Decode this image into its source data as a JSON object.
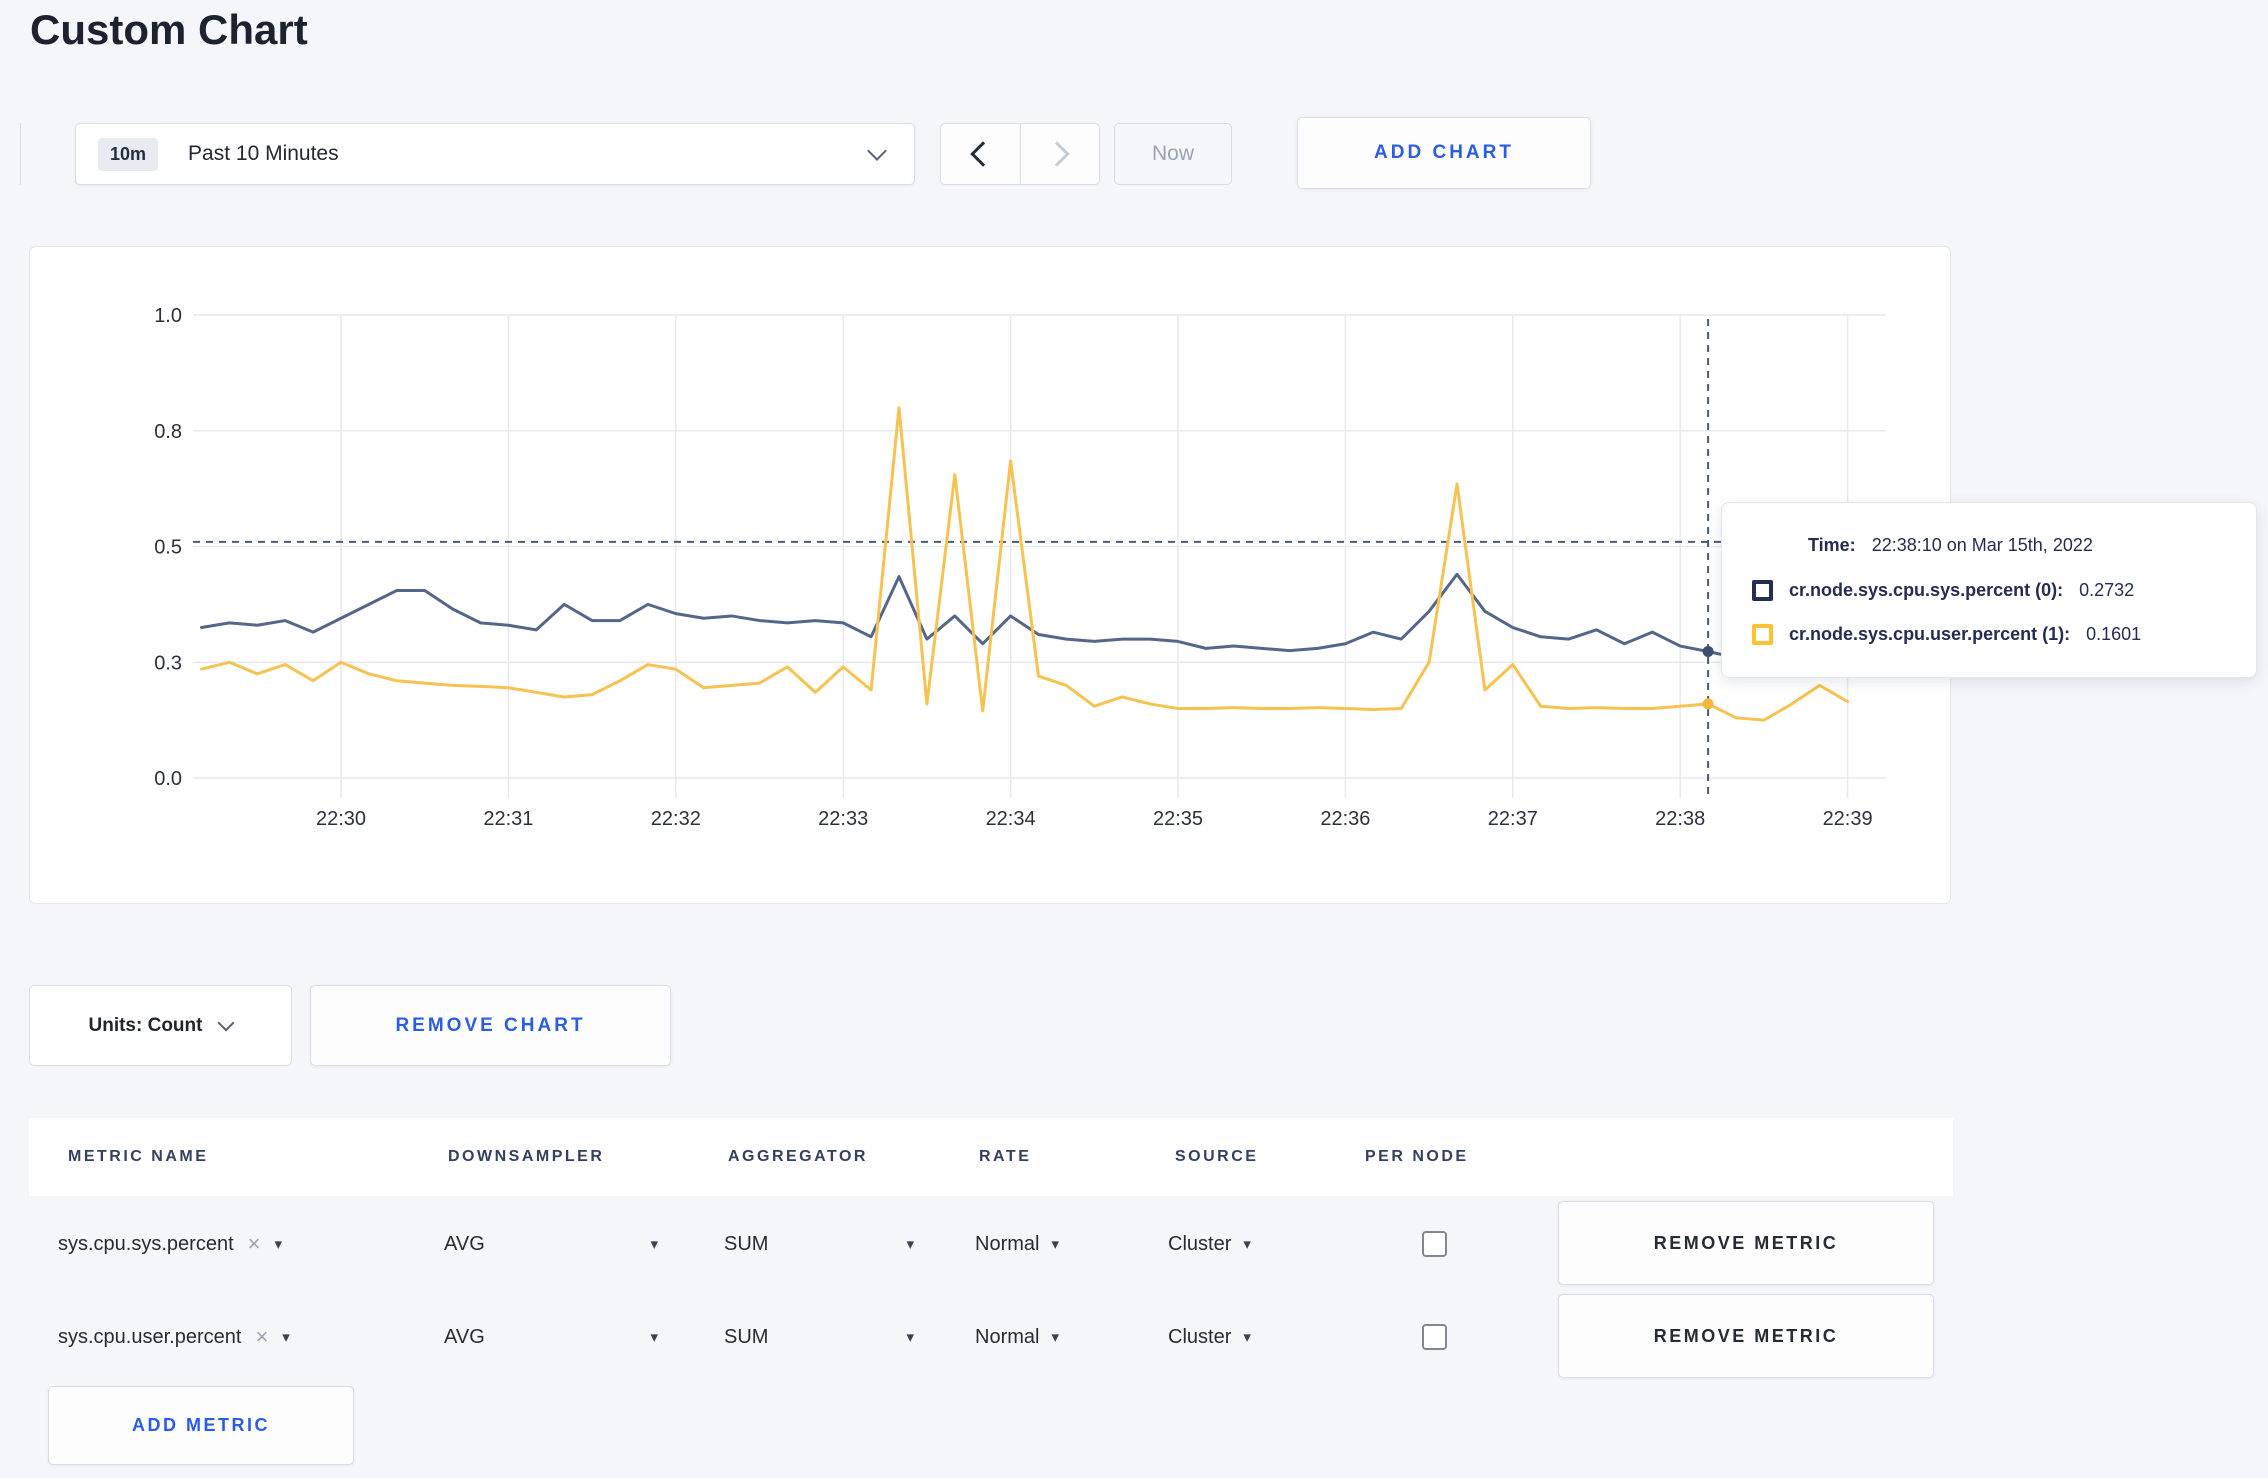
{
  "page": {
    "title": "Custom Chart",
    "background": "#f4f6fa",
    "accent_blue": "#2a5ce4"
  },
  "toolbar": {
    "time_window_badge": "10m",
    "time_window_label": "Past 10 Minutes",
    "now_label": "Now",
    "add_chart_label": "ADD CHART"
  },
  "chart": {
    "tooltip": {
      "time_label": "Time:",
      "time_value": "22:38:10 on Mar 15th, 2022",
      "rows": [
        {
          "label": "cr.node.sys.cpu.sys.percent (0):",
          "value": "0.2732",
          "swatch": "#242f55"
        },
        {
          "label": "cr.node.sys.cpu.user.percent (1):",
          "value": "0.1601",
          "swatch": "#fdc134"
        }
      ]
    }
  },
  "chart_data": {
    "type": "line",
    "title": "",
    "xlabel": "",
    "ylabel": "",
    "ylim": [
      0,
      1
    ],
    "grid": true,
    "x_start": "22:29:10",
    "x_interval_seconds": 10,
    "x_tick_labels": [
      "22:30",
      "22:31",
      "22:32",
      "22:33",
      "22:34",
      "22:35",
      "22:36",
      "22:37",
      "22:38",
      "22:39"
    ],
    "y_ticks": [
      {
        "value": 0.0,
        "label": "0.0"
      },
      {
        "value": 0.25,
        "label": "0.3"
      },
      {
        "value": 0.5,
        "label": "0.5"
      },
      {
        "value": 0.75,
        "label": "0.8"
      },
      {
        "value": 1.0,
        "label": "1.0"
      }
    ],
    "series": [
      {
        "name": "cr.node.sys.cpu.sys.percent",
        "color": "#54668a",
        "values": [
          0.325,
          0.335,
          0.33,
          0.34,
          0.315,
          0.345,
          0.375,
          0.405,
          0.405,
          0.365,
          0.335,
          0.33,
          0.32,
          0.375,
          0.34,
          0.34,
          0.375,
          0.355,
          0.345,
          0.35,
          0.34,
          0.335,
          0.34,
          0.335,
          0.305,
          0.435,
          0.3,
          0.35,
          0.29,
          0.35,
          0.31,
          0.3,
          0.295,
          0.3,
          0.3,
          0.295,
          0.28,
          0.285,
          0.28,
          0.275,
          0.28,
          0.29,
          0.315,
          0.3,
          0.36,
          0.44,
          0.36,
          0.325,
          0.305,
          0.3,
          0.32,
          0.29,
          0.315,
          0.285,
          0.2732,
          0.26,
          0.285,
          0.31,
          0.3,
          0.29
        ]
      },
      {
        "name": "cr.node.sys.cpu.user.percent",
        "color": "#f6c251",
        "values": [
          0.235,
          0.25,
          0.225,
          0.245,
          0.21,
          0.25,
          0.225,
          0.21,
          0.205,
          0.2,
          0.198,
          0.195,
          0.185,
          0.175,
          0.18,
          0.21,
          0.245,
          0.235,
          0.195,
          0.2,
          0.205,
          0.24,
          0.185,
          0.24,
          0.19,
          0.8,
          0.16,
          0.655,
          0.145,
          0.685,
          0.22,
          0.2,
          0.155,
          0.175,
          0.16,
          0.15,
          0.15,
          0.152,
          0.15,
          0.15,
          0.152,
          0.15,
          0.148,
          0.15,
          0.25,
          0.635,
          0.19,
          0.245,
          0.155,
          0.15,
          0.152,
          0.15,
          0.15,
          0.155,
          0.1601,
          0.13,
          0.125,
          0.16,
          0.2,
          0.165
        ]
      }
    ],
    "hover": {
      "time": "22:38:10",
      "x_index": 54,
      "hline_value": 0.51,
      "values": [
        0.2732,
        0.1601
      ],
      "dot_colors": [
        "#3d4e6e",
        "#f2b83e"
      ],
      "crosshair_color": "#4a5a74"
    },
    "legend_position": "tooltip-only"
  },
  "units_row": {
    "units_label": "Units: Count",
    "remove_chart_label": "REMOVE CHART"
  },
  "metrics_table": {
    "headers": [
      "METRIC NAME",
      "DOWNSAMPLER",
      "AGGREGATOR",
      "RATE",
      "SOURCE",
      "PER NODE"
    ],
    "rows": [
      {
        "metric": "sys.cpu.sys.percent",
        "remove_icon": "×",
        "downsampler": "AVG",
        "aggregator": "SUM",
        "rate": "Normal",
        "source": "Cluster",
        "per_node_checked": false,
        "remove_label": "REMOVE METRIC"
      },
      {
        "metric": "sys.cpu.user.percent",
        "remove_icon": "×",
        "downsampler": "AVG",
        "aggregator": "SUM",
        "rate": "Normal",
        "source": "Cluster",
        "per_node_checked": false,
        "remove_label": "REMOVE METRIC"
      }
    ],
    "dropdown_icon": "▾",
    "add_metric_label": "ADD METRIC"
  }
}
